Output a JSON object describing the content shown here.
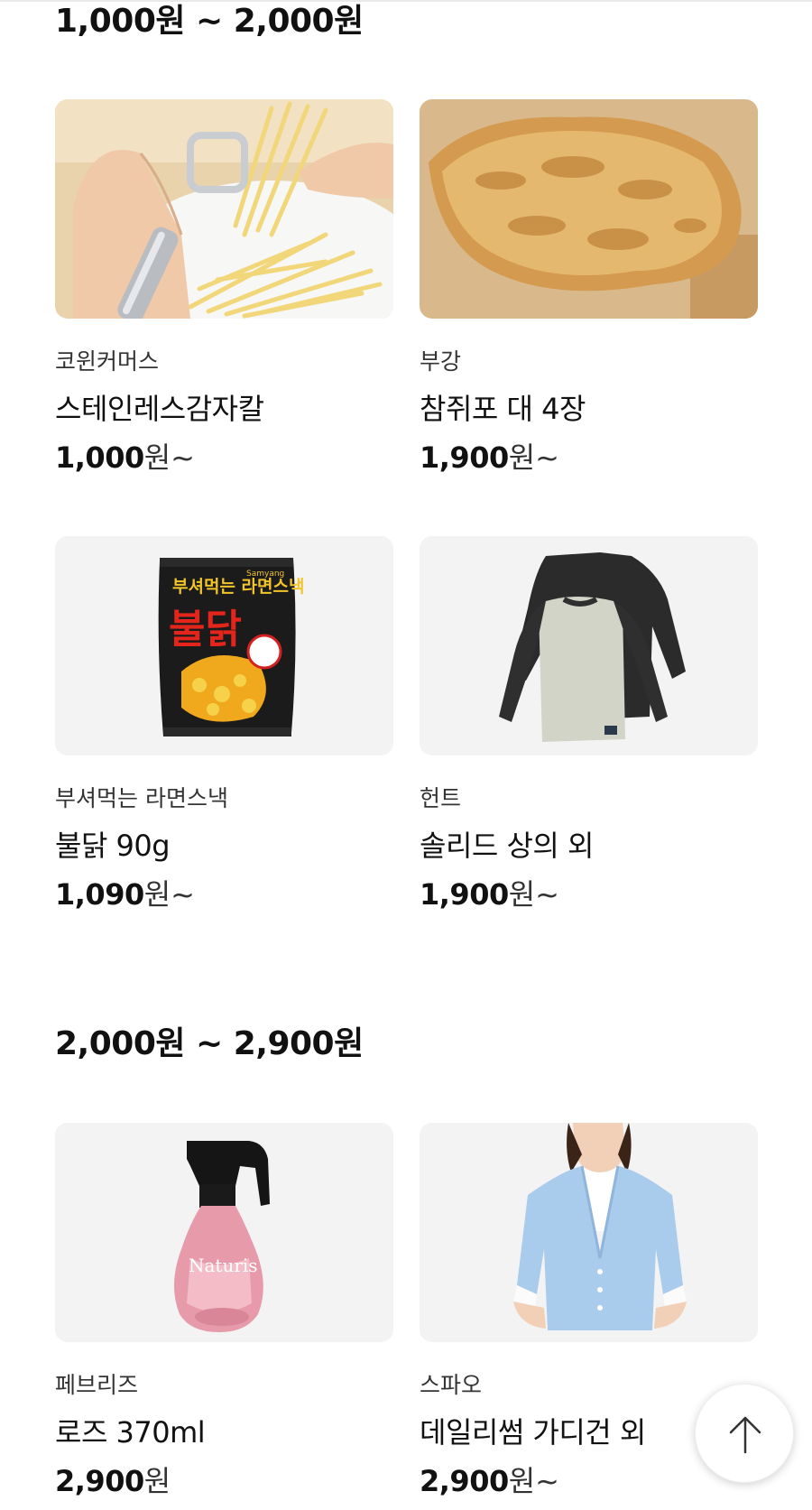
{
  "sections": [
    {
      "title": "1,000원 ~ 2,000원",
      "products": [
        {
          "brand": "코윈커머스",
          "name": "스테인레스감자칼",
          "price": "1,000",
          "unit": "원~"
        },
        {
          "brand": "부강",
          "name": "참쥐포 대 4장",
          "price": "1,900",
          "unit": "원~"
        },
        {
          "brand": "부셔먹는 라면스낵",
          "name": "불닭 90g",
          "price": "1,090",
          "unit": "원~"
        },
        {
          "brand": "헌트",
          "name": "솔리드 상의 외",
          "price": "1,900",
          "unit": "원~"
        }
      ]
    },
    {
      "title": "2,000원 ~ 2,900원",
      "products": [
        {
          "brand": "페브리즈",
          "name": "로즈 370ml",
          "price": "2,900",
          "unit": "원"
        },
        {
          "brand": "스파오",
          "name": "데일리썸 가디건 외",
          "price": "2,900",
          "unit": "원~"
        }
      ]
    }
  ],
  "snack_package": {
    "headline": "부셔먹는 라면스낵",
    "big_text": "불닭",
    "maker": "Samyang"
  },
  "spray_label": "Naturis",
  "icons": {
    "scroll_top": "arrow-up-icon"
  },
  "colors": {
    "text": "#111111",
    "subtext": "#333333",
    "thumb_bg": "#f3f3f3"
  }
}
